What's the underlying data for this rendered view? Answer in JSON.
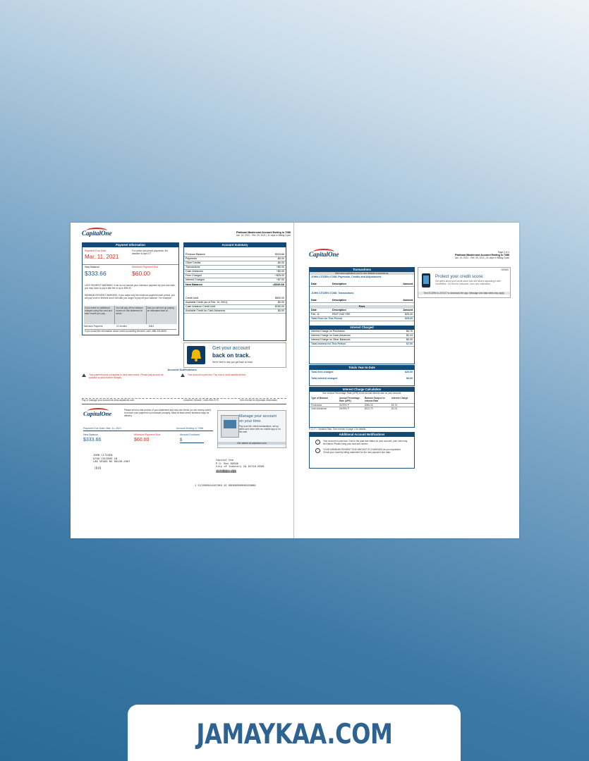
{
  "brand": {
    "logo": "CapitalOne"
  },
  "left": {
    "header_right": {
      "title": "Platinum Mastercard Account Ending in 7288",
      "sub": "Jan. 10, 2021 - Feb. 09, 2021 | 31 days in Billing Cycle"
    },
    "payment_info": {
      "title": "Payment Information",
      "due_label": "Payment Due Date",
      "due_date": "Mar. 11, 2021",
      "due_note": "For online and phone payments, the deadline is 8pm ET",
      "new_balance_label": "New Balance",
      "new_balance": "$333.66",
      "min_label": "Minimum Payment Due",
      "min_value": "$60.00",
      "late_warning": "LATE PAYMENT WARNING: If we do not receive your minimum payment by your due date, you may have to pay a late fee of up to $39.00.",
      "min_warning": "MINIMUM PAYMENT WARNING: If you make only the minimum payment each period, you will pay more in interest and it will take you longer to pay off your balance. For example:",
      "table_cols": [
        "If you make no additional charges using this card and each month you pay...",
        "You will pay off the balance shown on this statement in about...",
        "And you will end up paying an estimated total of..."
      ],
      "table_row": [
        "Minimum Payment",
        "21 Months",
        "$363"
      ],
      "footer": "If you would like information about credit counseling services, call 1-888-326-8055."
    },
    "account_summary": {
      "title": "Account Summary",
      "rows": [
        {
          "label": "Previous Balance",
          "value": "$333.66"
        },
        {
          "label": "Payments",
          "value": "-$0.00"
        },
        {
          "label": "Other Credits",
          "value": "-$0.00"
        },
        {
          "label": "Transactions",
          "value": "+$0.00"
        },
        {
          "label": "Cash Advances",
          "value": "+$0.00"
        },
        {
          "label": "Fees Charged",
          "value": "+$25.00"
        },
        {
          "label": "Interest Charged",
          "value": "+$7.00"
        }
      ],
      "new_balance_label": "New Balance",
      "new_balance": "=$333.66",
      "credit_rows": [
        {
          "label": "Credit Limit",
          "value": "$500.00"
        },
        {
          "label": "Available Credit (as of Feb. 10, 2021)",
          "value": "$0.00"
        },
        {
          "label": "Cash Advance Credit Limit",
          "value": "$150.00"
        },
        {
          "label": "Available Credit for Cash Advances",
          "value": "$0.00"
        }
      ]
    },
    "promo": {
      "line1": "Get your account",
      "line2": "back on track.",
      "sub": "We're here to help you get back on track"
    },
    "notifications": {
      "title": "Account Notifications",
      "left": "Your payment does not appear to have been made. Please pay as soon as possible to avoid further charges.",
      "right": "Your account is past due. Pay now to avoid additional fees."
    },
    "pay_line": "Pay or manage your account at www.capitalone.com",
    "customer_service": "Customer Service: 1-800-955-7070",
    "see_reverse": "See reverse for Important Information",
    "coupon": {
      "note": "Please send us this portion of your statement and only one check (or one money order) to ensure your payment is processed promptly. Allow at least seven business days for delivery.",
      "due_label": "Payment Due Date: Mar. 11, 2021",
      "acct_label": "Account Ending in 7288",
      "nb_label": "New Balance",
      "nb_value": "$333.66",
      "min_label": "Minimum Payment Due",
      "min_value": "$60.00",
      "enclosed_label": "Amount Enclosed",
      "enclosed_value": "$",
      "promo_title": "Manage your account",
      "promo_title2": "on your time.",
      "promo_sub": "Pay your bill, check transactions, set up alerts and more with our mobile app or on the web.",
      "promo_url": "Get started at capitalone.com",
      "address": [
        "JOHN CITIZEN",
        "9789 COLOSSO LN",
        "LAS VEGAS NV 89130-2067"
      ],
      "remit": [
        "Capital One",
        "P.O. Box 60599",
        "City of Industry CA 91716-0599"
      ],
      "ocr": "1  517805851587288  15  00060000000333666"
    }
  },
  "right": {
    "header_right": {
      "title": "Platinum Mastercard Account Ending in 7288",
      "sub": "Jan. 10, 2021 - Feb. 09, 2021 | 31 days in Billing Cycle",
      "page": "Page 2 of 4"
    },
    "transactions": {
      "title": "Transactions",
      "visit_line": "Visit www.capitalone.com to see detailed transactions.",
      "section1": "JOHN CITIZEN #7288: Payments, Credits and Adjustments",
      "section2": "JOHN CITIZEN #7288: Transactions",
      "cols": [
        "Date",
        "Description",
        "Amount"
      ]
    },
    "fees": {
      "title": "Fees",
      "cols": [
        "Date",
        "Description",
        "Amount"
      ],
      "row": {
        "date": "Feb. 11",
        "desc": "PAST DUE FEE",
        "amount": "$25.00"
      },
      "total_label": "Total Fees for This Period",
      "total_value": "$25.00"
    },
    "interest": {
      "title": "Interest Charged",
      "rows": [
        {
          "label": "Interest Charge on Purchases",
          "value": "$4.76"
        },
        {
          "label": "Interest Charge on Cash Advances",
          "value": "$2.24"
        },
        {
          "label": "Interest Charge on Other Balances",
          "value": "$0.00"
        }
      ],
      "total_label": "Total Interest for This Period",
      "total_value": "$7.00"
    },
    "ytd": {
      "title": "Totals Year-to-Date",
      "fees_label": "Total fees charged",
      "fees_value": "$25.00",
      "int_label": "Total interest charged",
      "int_value": "$9.00"
    },
    "calc": {
      "title": "Interest Charge Calculation",
      "sub": "Your Annual Percentage Rate (APR) is the annual interest rate on your account.",
      "cols": [
        "Type of Balance",
        "Annual Percentage Rate (APR)",
        "Balance Subject to Interest Rate",
        "Interest Charge"
      ],
      "rows": [
        [
          "Purchases",
          "26.99% P",
          "$256.33",
          "$4.76"
        ],
        [
          "Cash Advances",
          "26.99% P",
          "$102.79",
          "$2.24"
        ]
      ],
      "note": "P, D, F = Variable Rate. See reverse of page 1 for details."
    },
    "add_notif": {
      "title": "Additional Account Notifications",
      "items": [
        "Your account is past due. Due to the past due status on your account, your card may be limited. Please bring your account current.",
        "YOUR MINIMUM PAYMENT DUE AMOUNT IS CHANGING as you requested. Check your monthly billing statement for the new payment due date."
      ]
    },
    "promo": {
      "title": "Protect your credit score.",
      "sub": "Get alerts about your credit score and see what's impacting it with CreditWise - it's free for everyone, even non-customers.",
      "code": "GEN00",
      "cta": "Text SCORE to 227227 to download the app. Message and data rates may apply."
    }
  },
  "watermark": {
    "text": "JAMAYKAA.COM"
  },
  "colors": {
    "navy": "#114a77",
    "red": "#d03027",
    "accent": "#2e6291"
  }
}
